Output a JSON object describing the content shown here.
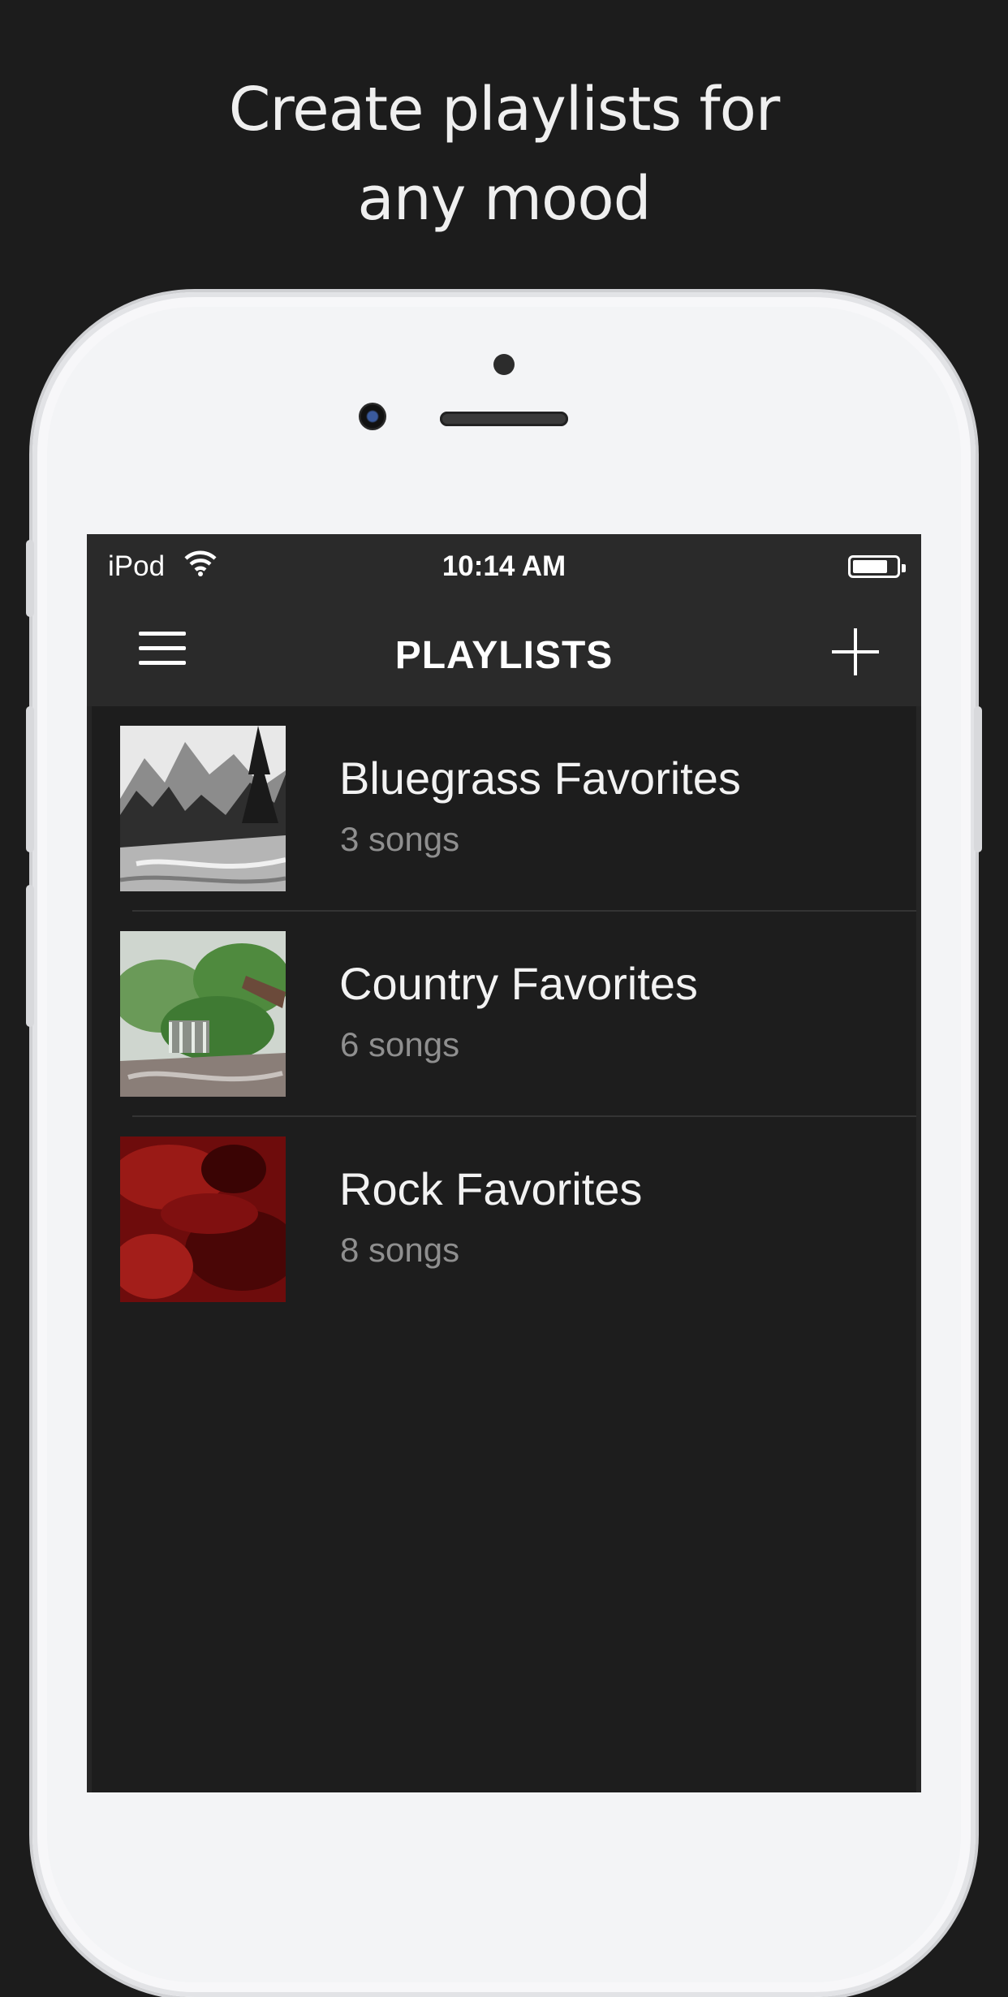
{
  "headline": {
    "line1": "Create playlists for",
    "line2": "any mood"
  },
  "status_bar": {
    "carrier": "iPod",
    "time": "10:14 AM",
    "battery_level": 0.8
  },
  "nav": {
    "title": "PLAYLISTS"
  },
  "playlists": [
    {
      "title": "Bluegrass Favorites",
      "subtitle": "3 songs",
      "art": "mountain-river-bw"
    },
    {
      "title": "Country Favorites",
      "subtitle": "6 songs",
      "art": "forest-waterfall"
    },
    {
      "title": "Rock Favorites",
      "subtitle": "8 songs",
      "art": "red-rock-texture"
    }
  ],
  "colors": {
    "background": "#1c1c1c",
    "bar": "#2a2a2a",
    "text": "#f2f2f2",
    "subtext": "#8f8f8f"
  }
}
